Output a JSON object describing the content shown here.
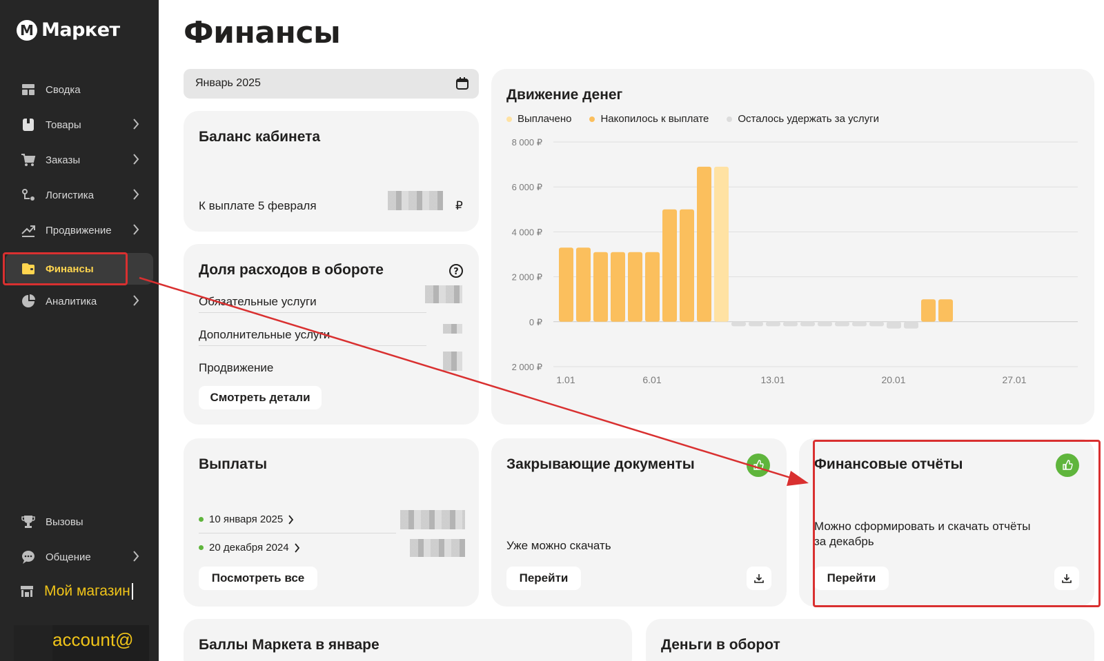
{
  "sidebar": {
    "logo": "Маркет",
    "items": [
      {
        "label": "Сводка",
        "icon": "dashboard-icon",
        "chevron": false
      },
      {
        "label": "Товары",
        "icon": "box-icon",
        "chevron": true
      },
      {
        "label": "Заказы",
        "icon": "cart-icon",
        "chevron": true
      },
      {
        "label": "Логистика",
        "icon": "logistics-icon",
        "chevron": true
      },
      {
        "label": "Продвижение",
        "icon": "trend-icon",
        "chevron": true
      },
      {
        "label": "Финансы",
        "icon": "wallet-icon",
        "chevron": false,
        "active": true
      },
      {
        "label": "Аналитика",
        "icon": "pie-icon",
        "chevron": true
      }
    ],
    "bottom": [
      {
        "label": "Вызовы",
        "icon": "trophy-icon",
        "chevron": false
      },
      {
        "label": "Общение",
        "icon": "chat-icon",
        "chevron": true
      }
    ],
    "shop_label": "Мой магазин",
    "account_label": "account@"
  },
  "page": {
    "title": "Финансы"
  },
  "period": {
    "value": "Январь 2025"
  },
  "balance": {
    "title": "Баланс кабинета",
    "payout_label": "К выплате 5 февраля",
    "currency": "₽"
  },
  "expenses": {
    "title": "Доля расходов в обороте",
    "rows": [
      "Обязательные услуги",
      "Дополнительные услуги",
      "Продвижение"
    ],
    "button": "Смотреть детали"
  },
  "cashflow": {
    "title": "Движение денег",
    "legend": [
      {
        "label": "Выплачено",
        "color": "#ffe2a3"
      },
      {
        "label": "Накопилось к выплате",
        "color": "#fbbf5d"
      },
      {
        "label": "Осталось удержать за услуги",
        "color": "#dcdcdc"
      }
    ]
  },
  "chart_data": {
    "type": "bar",
    "y_tick_labels": [
      "8 000 ₽",
      "6 000 ₽",
      "4 000 ₽",
      "2 000 ₽",
      "0 ₽",
      "2 000 ₽"
    ],
    "y_tick_values": [
      8000,
      6000,
      4000,
      2000,
      0,
      -2000
    ],
    "ylim": [
      -2000,
      8000
    ],
    "x_tick_labels": [
      "1.01",
      "6.01",
      "13.01",
      "20.01",
      "27.01"
    ],
    "x_tick_days": [
      1,
      6,
      13,
      20,
      27
    ],
    "days": [
      1,
      2,
      3,
      4,
      5,
      6,
      7,
      8,
      9,
      10,
      11,
      12,
      13,
      14,
      15,
      16,
      17,
      18,
      19,
      20,
      21,
      22,
      23
    ],
    "values": [
      3300,
      3300,
      3100,
      3100,
      3100,
      3100,
      5000,
      5000,
      6900,
      6900,
      -200,
      -200,
      -200,
      -200,
      -200,
      -200,
      -200,
      -200,
      -200,
      -300,
      -300,
      1000,
      1000
    ],
    "kinds": [
      "acc",
      "acc",
      "acc",
      "acc",
      "acc",
      "acc",
      "acc",
      "acc",
      "acc",
      "paid",
      "held",
      "held",
      "held",
      "held",
      "held",
      "held",
      "held",
      "held",
      "held",
      "held",
      "held",
      "acc",
      "acc"
    ],
    "colors": {
      "acc": "#fbbf5d",
      "paid": "#ffe2a3",
      "held": "#dcdcdc"
    }
  },
  "payouts": {
    "title": "Выплаты",
    "items": [
      "10 января 2025",
      "20 декабря 2024"
    ],
    "button": "Посмотреть все",
    "status_color": "#5fb53c"
  },
  "docs": {
    "title": "Закрывающие документы",
    "note": "Уже можно скачать",
    "button": "Перейти"
  },
  "reports": {
    "title": "Финансовые отчёты",
    "note_line1": "Можно сформировать и скачать отчёты",
    "note_line2": "за декабрь",
    "button": "Перейти"
  },
  "points": {
    "title": "Баллы Маркета в январе"
  },
  "turnover": {
    "title": "Деньги в оборот"
  }
}
